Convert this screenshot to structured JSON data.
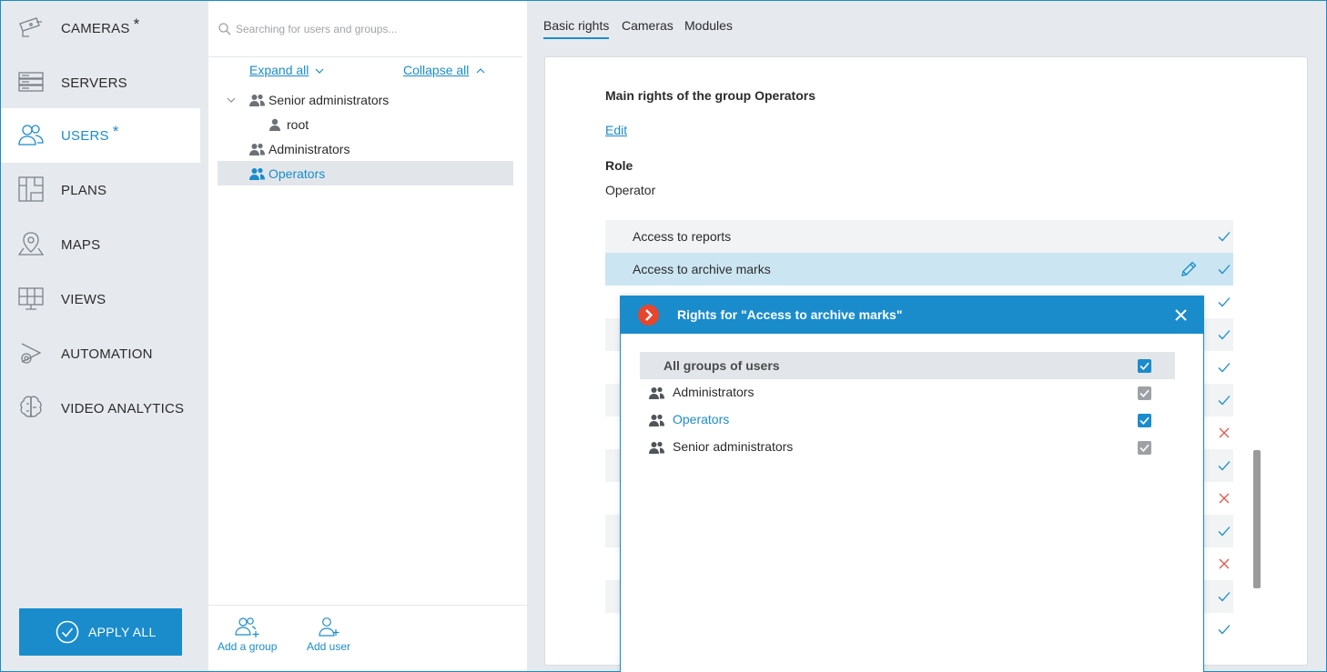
{
  "nav": {
    "items": [
      {
        "label": "CAMERAS",
        "starred": "*",
        "icon": "camera-icon"
      },
      {
        "label": "SERVERS",
        "starred": "",
        "icon": "server-icon"
      },
      {
        "label": "USERS",
        "starred": "*",
        "icon": "users-icon"
      },
      {
        "label": "PLANS",
        "starred": "",
        "icon": "plan-icon"
      },
      {
        "label": "MAPS",
        "starred": "",
        "icon": "map-pin-icon"
      },
      {
        "label": "VIEWS",
        "starred": "",
        "icon": "views-icon"
      },
      {
        "label": "AUTOMATION",
        "starred": "",
        "icon": "automation-icon"
      },
      {
        "label": "VIDEO ANALYTICS",
        "starred": "",
        "icon": "brain-icon"
      }
    ],
    "apply_label": "APPLY ALL"
  },
  "tree": {
    "search_placeholder": "Searching for users and groups...",
    "expand_all": "Expand all",
    "collapse_all": "Collapse all",
    "nodes": {
      "senior": "Senior administrators",
      "root": "root",
      "administrators": "Administrators",
      "operators": "Operators"
    },
    "add_group": "Add a group",
    "add_user": "Add user"
  },
  "tabs": [
    "Basic rights",
    "Cameras",
    "Modules"
  ],
  "rights": {
    "title": "Main rights of the group Operators",
    "edit": "Edit",
    "role_label": "Role",
    "role_value": "Operator",
    "items": [
      {
        "label": "Access to reports",
        "state": "check"
      },
      {
        "label": "Access to archive marks",
        "state": "check"
      }
    ],
    "hidden_states": [
      "check",
      "check",
      "check",
      "check",
      "cross",
      "check",
      "cross",
      "check",
      "cross",
      "check",
      "check"
    ]
  },
  "dialog": {
    "title": "Rights for \"Access to archive marks\"",
    "all_label": "All groups of users",
    "rows": [
      {
        "label": "Administrators",
        "checkbox": "gray"
      },
      {
        "label": "Operators",
        "checkbox": "blue"
      },
      {
        "label": "Senior administrators",
        "checkbox": "gray"
      }
    ]
  },
  "colors": {
    "accent": "#1a8ccc",
    "check": "#1a8ccc",
    "cross": "#e2574c",
    "highlight_row": "#cbe6f2"
  }
}
